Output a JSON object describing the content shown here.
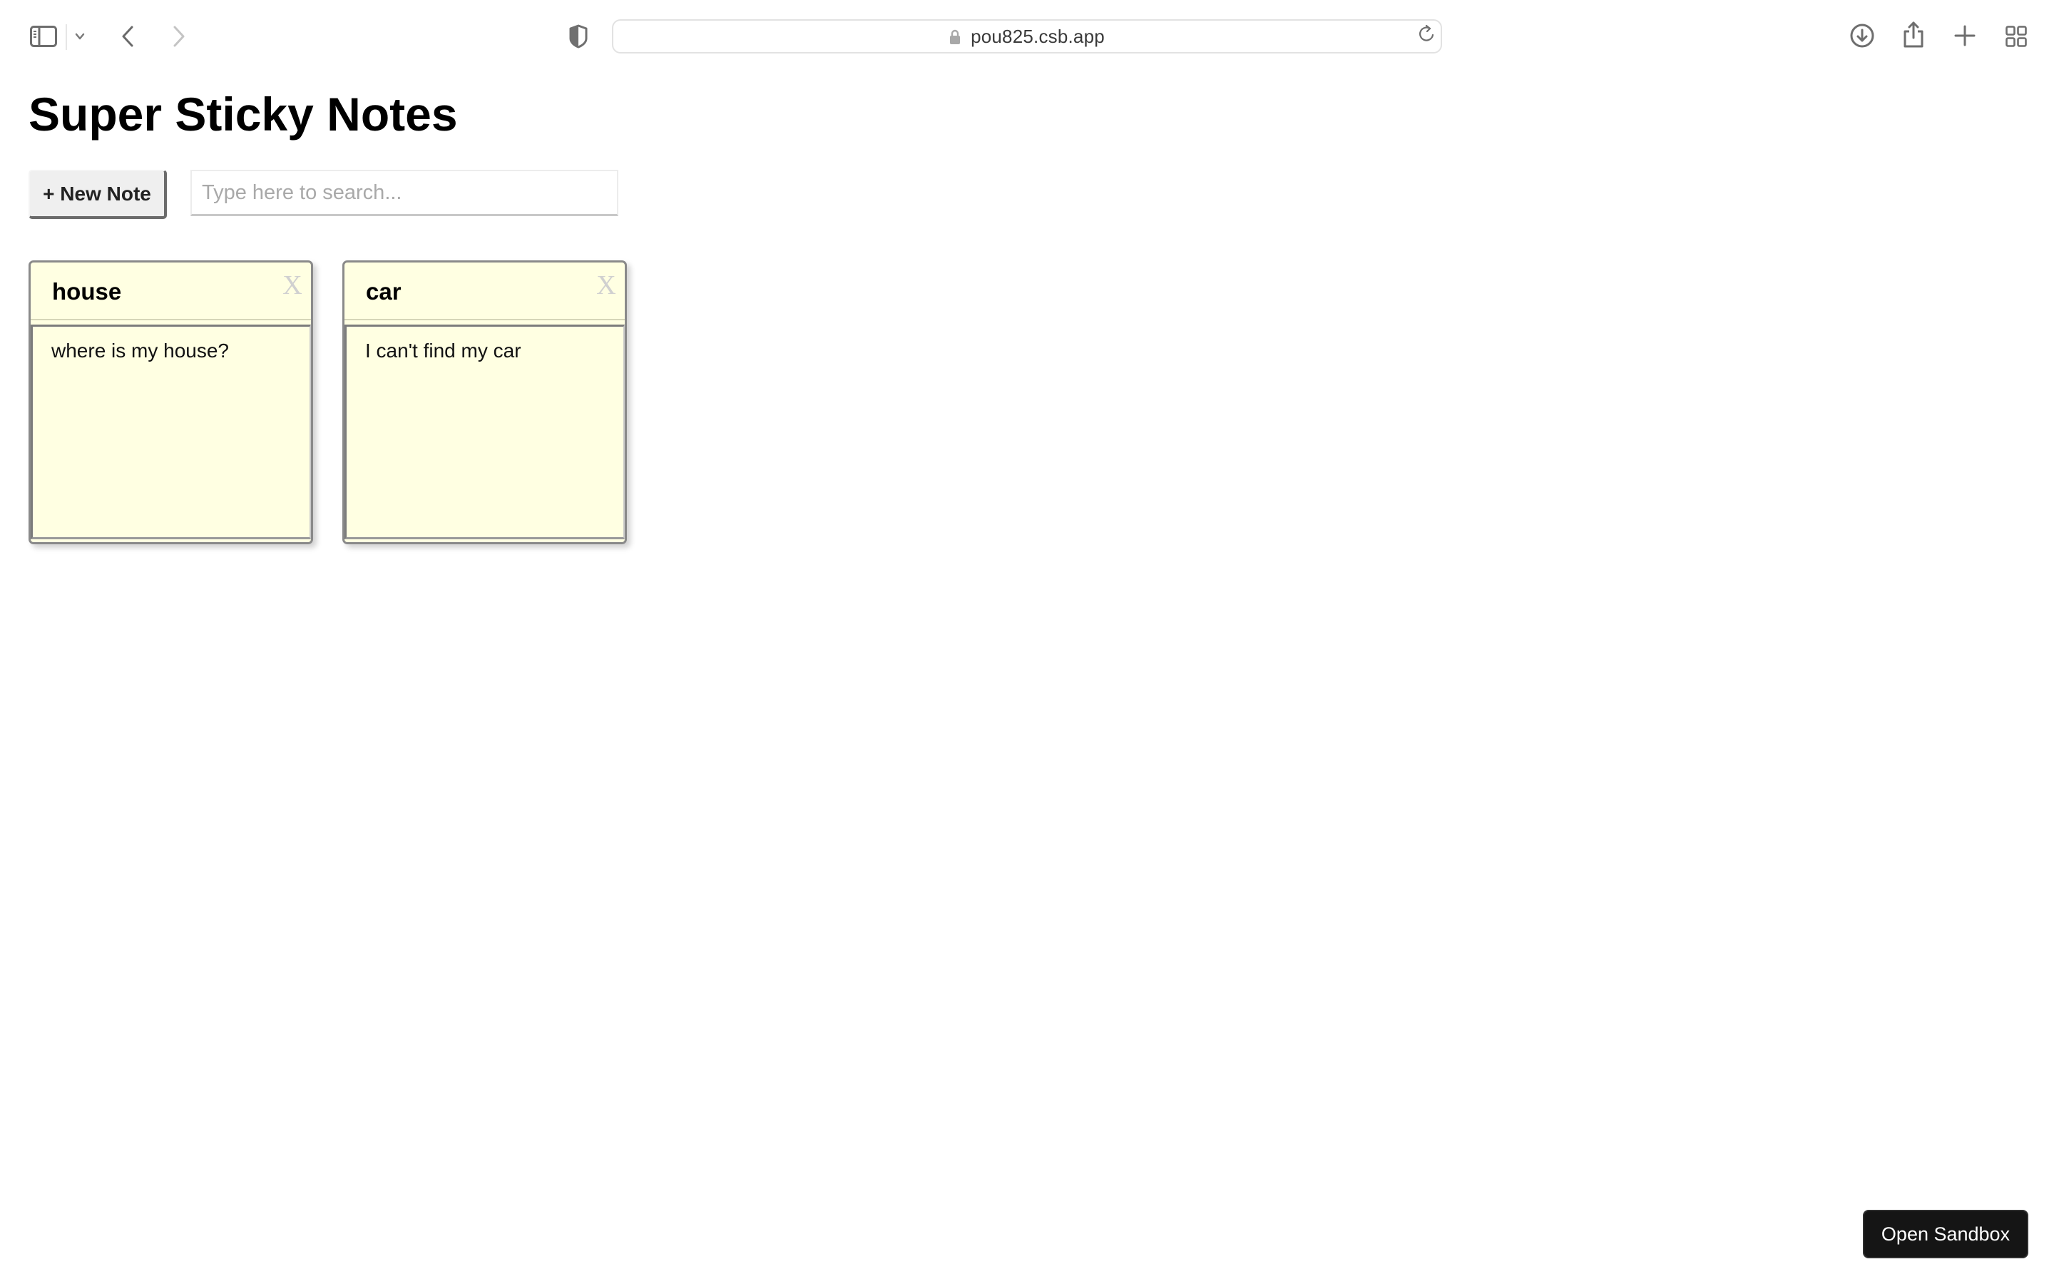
{
  "browser": {
    "url": "pou825.csb.app",
    "icons": {
      "sidebar": "sidebar-toggle-icon",
      "tab_group_menu": "chevron-down-icon",
      "back": "chevron-left-icon",
      "forward": "chevron-right-icon",
      "privacy": "shield-icon",
      "lock": "lock-icon",
      "reload": "reload-icon",
      "downloads": "download-icon",
      "share": "share-icon",
      "new_tab": "plus-icon",
      "tab_overview": "grid-icon"
    }
  },
  "app": {
    "title": "Super Sticky Notes",
    "new_note_label": "+ New Note",
    "search": {
      "value": "",
      "placeholder": "Type here to search..."
    },
    "notes": [
      {
        "title": "house",
        "body": "where is my house?",
        "close_label": "X"
      },
      {
        "title": "car",
        "body": "I can't find my car",
        "close_label": "X"
      }
    ],
    "note_color": "#ffffe2"
  },
  "footer": {
    "open_sandbox_label": "Open Sandbox"
  }
}
